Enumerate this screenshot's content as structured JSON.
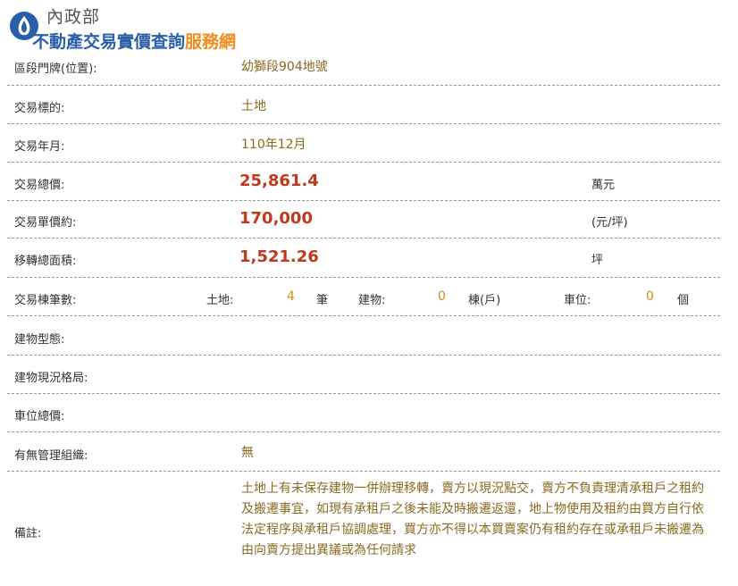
{
  "header": {
    "ministry": "內政部",
    "title_main": "不動產交易實價查詢",
    "title_accent": "服務網"
  },
  "rows": {
    "address": {
      "label": "區段門牌(位置):",
      "value": "幼獅段904地號"
    },
    "target": {
      "label": "交易標的:",
      "value": "土地"
    },
    "date": {
      "label": "交易年月:",
      "value": "110年12月"
    },
    "total_price": {
      "label": "交易總價:",
      "value": "25,861.4",
      "unit": "萬元"
    },
    "unit_price": {
      "label": "交易單價約:",
      "value": "170,000",
      "unit": "(元/坪)"
    },
    "area": {
      "label": "移轉總面積:",
      "value": "1,521.26",
      "unit": "坪"
    },
    "counts": {
      "label": "交易棟筆數:",
      "land_label": "土地:",
      "land_value": "4",
      "land_unit": "筆",
      "building_label": "建物:",
      "building_value": "0",
      "building_unit": "棟(戶)",
      "parking_label": "車位:",
      "parking_value": "0",
      "parking_unit": "個"
    },
    "building_type": {
      "label": "建物型態:",
      "value": ""
    },
    "layout": {
      "label": "建物現況格局:",
      "value": ""
    },
    "parking_total": {
      "label": "車位總價:",
      "value": ""
    },
    "management": {
      "label": "有無管理組織:",
      "value": "無"
    },
    "remarks": {
      "label": "備註:",
      "value": "土地上有未保存建物一併辦理移轉，賣方以現況點交，賣方不負責理清承租戶之租約及搬遷事宜，如現有承租戶之後未能及時搬遷返還，地上物使用及租約由買方自行依法定程序與承租戶協調處理，買方亦不得以本買賣案仍有租約存在或承租戶未搬遷為由向賣方提出異議或為任何請求"
    }
  },
  "colors": {
    "accent": "#f08c1c",
    "brand": "#2a5ea8",
    "price": "#c0391b",
    "value": "#8a6a20"
  }
}
